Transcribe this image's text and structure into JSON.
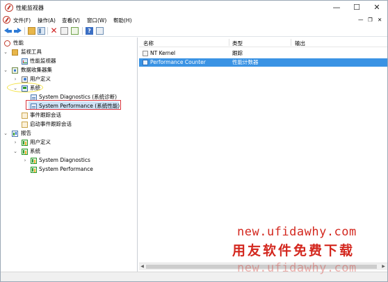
{
  "window": {
    "title": "性能监视器",
    "minimize": "—",
    "maximize": "☐",
    "close": "✕"
  },
  "menu": {
    "items": [
      "文件(F)",
      "操作(A)",
      "查看(V)",
      "窗口(W)",
      "帮助(H)"
    ],
    "right_minimize": "—",
    "right_restore": "❐",
    "right_close": "✕"
  },
  "toolbar": {
    "delete_glyph": "✕",
    "help_glyph": "?"
  },
  "tree": {
    "root": "性能",
    "monitoring_tools": "监视工具",
    "perf_monitor": "性能监视器",
    "data_collector_sets": "数据收集器集",
    "user_defined": "用户定义",
    "system": "系统",
    "sys_diagnostics": "System Diagnostics (系统诊断)",
    "sys_performance": "System Performance (系统性能)",
    "event_trace_sessions": "事件跟踪会话",
    "startup_event_trace_sessions": "启动事件跟踪会话",
    "reports": "报告",
    "reports_user_defined": "用户定义",
    "reports_system": "系统",
    "reports_sys_diagnostics": "System Diagnostics",
    "reports_sys_performance": "System Performance"
  },
  "list": {
    "headers": {
      "name": "名称",
      "type": "类型",
      "output": "输出"
    },
    "rows": [
      {
        "name": "NT Kernel",
        "type": "跟踪"
      },
      {
        "name": "Performance Counter",
        "type": "性能计数器"
      }
    ]
  },
  "watermark": {
    "line1": "new.ufidawhy.com",
    "line2": "用友软件免费下载",
    "line3": "new.ufidawhy.com"
  },
  "colors": {
    "selection": "#3a93e4",
    "annotation_red": "#d9363e",
    "annotation_yellow": "#f3e34a",
    "watermark": "#d3271e"
  }
}
